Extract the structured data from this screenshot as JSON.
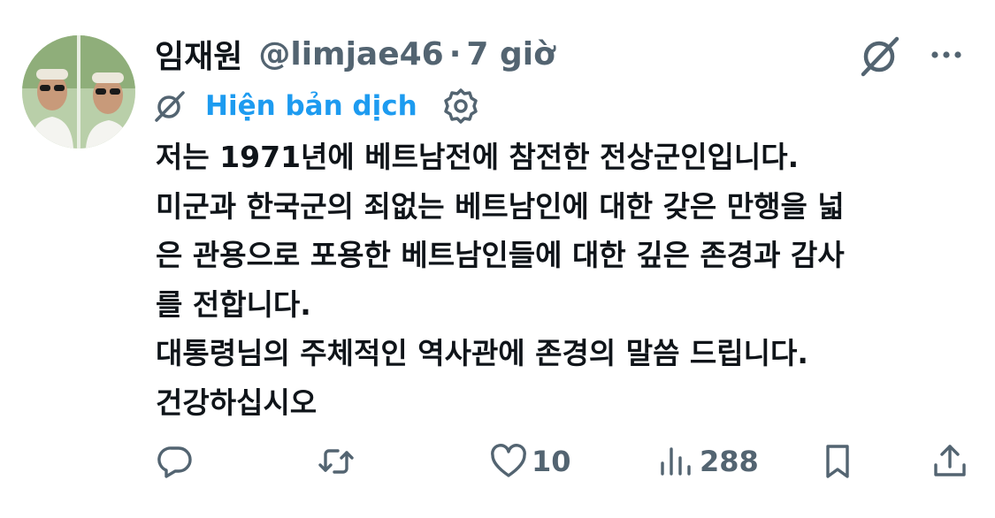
{
  "author": {
    "display_name": "임재원",
    "handle": "@limjae46",
    "separator": "·",
    "time": "7 giờ"
  },
  "translation": {
    "label": "Hiện bản dịch"
  },
  "body_lines": [
    "저는 1971년에 베트남전에 참전한 전상군인입니다.",
    "미군과 한국군의 죄없는 베트남인에 대한 갖은 만행을 넓",
    "은 관용으로 포용한 베트남인들에 대한 깊은 존경과 감사",
    "를 전합니다.",
    "대통령님의  주체적인 역사관에 존경의 말씀 드립니다.",
    "건강하십시오"
  ],
  "actions": {
    "reply": {
      "icon": "reply-icon"
    },
    "retweet": {
      "icon": "retweet-icon"
    },
    "like": {
      "icon": "heart-icon",
      "count": "10"
    },
    "views": {
      "icon": "views-chart-icon",
      "count": "288"
    },
    "bookmark": {
      "icon": "bookmark-icon"
    },
    "share": {
      "icon": "share-icon"
    }
  },
  "colors": {
    "text": "#0f1419",
    "secondary": "#536471",
    "accent": "#1d9bf0"
  }
}
